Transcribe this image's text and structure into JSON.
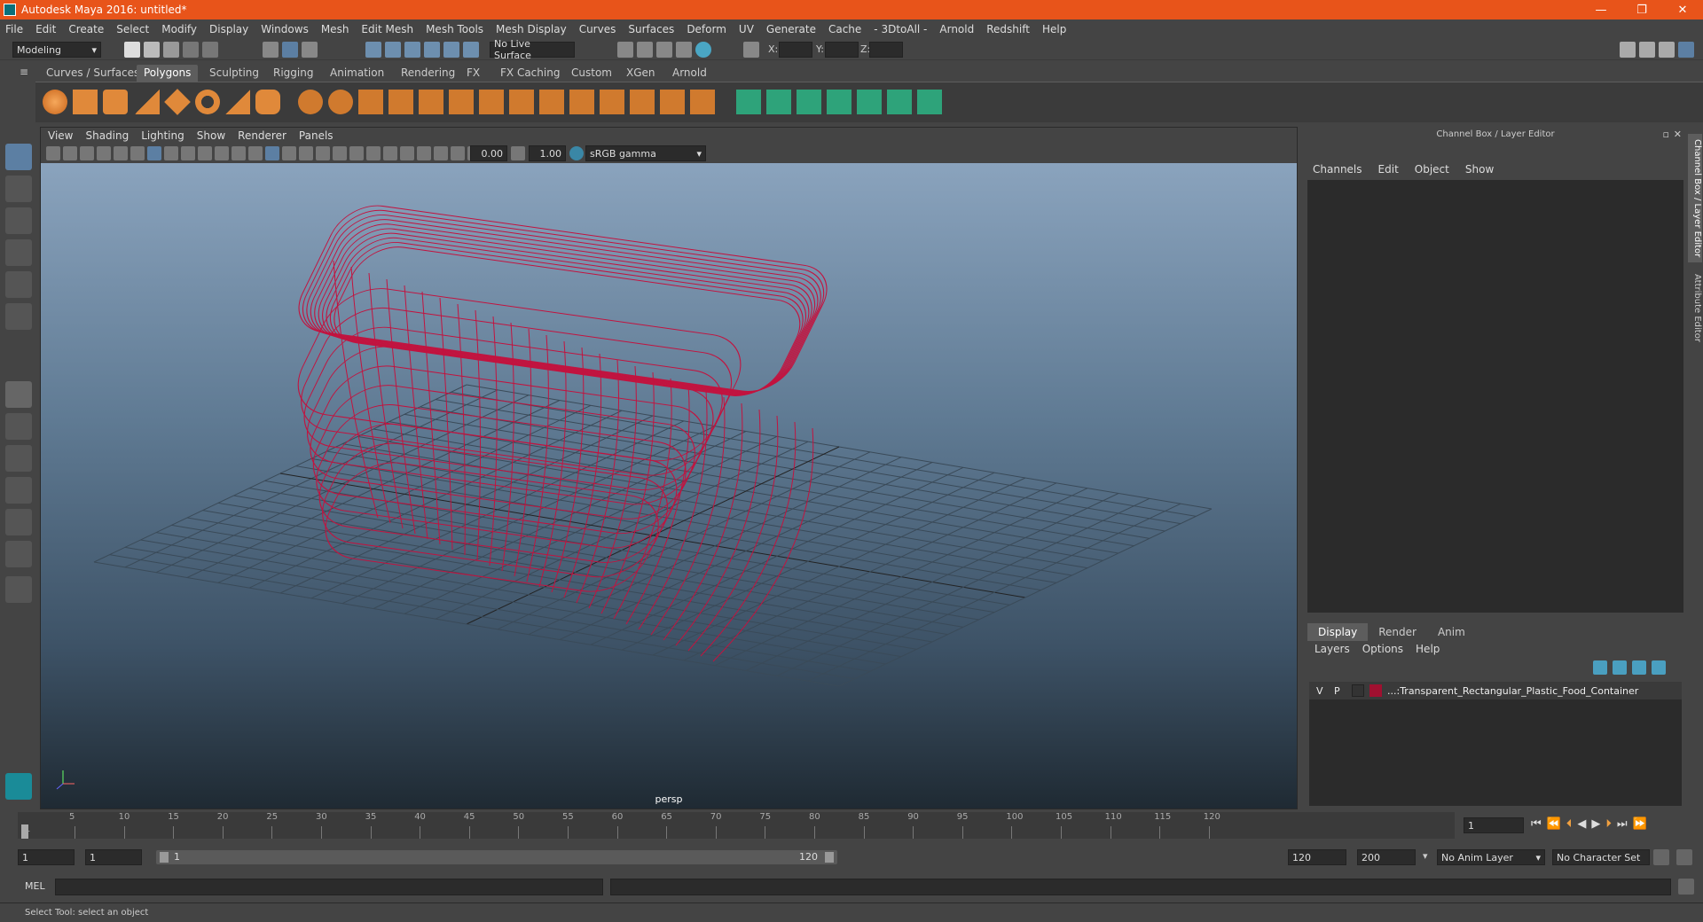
{
  "window": {
    "title": "Autodesk Maya 2016: untitled*",
    "buttons": [
      "—",
      "❐",
      "✕"
    ]
  },
  "menubar": [
    "File",
    "Edit",
    "Create",
    "Select",
    "Modify",
    "Display",
    "Windows",
    "Mesh",
    "Edit Mesh",
    "Mesh Tools",
    "Mesh Display",
    "Curves",
    "Surfaces",
    "Deform",
    "UV",
    "Generate",
    "Cache",
    "- 3DtoAll -",
    "Arnold",
    "Redshift",
    "Help"
  ],
  "statusline": {
    "mode": "Modeling",
    "live_surface": "No Live Surface",
    "x_label": "X:",
    "y_label": "Y:",
    "z_label": "Z:"
  },
  "shelf_tabs": [
    {
      "label": "Curves / Surfaces",
      "active": false
    },
    {
      "label": "Polygons",
      "active": true
    },
    {
      "label": "Sculpting",
      "active": false
    },
    {
      "label": "Rigging",
      "active": false
    },
    {
      "label": "Animation",
      "active": false
    },
    {
      "label": "Rendering",
      "active": false
    },
    {
      "label": "FX",
      "active": false
    },
    {
      "label": "FX Caching",
      "active": false
    },
    {
      "label": "Custom",
      "active": false
    },
    {
      "label": "XGen",
      "active": false
    },
    {
      "label": "Arnold",
      "active": false
    }
  ],
  "viewport": {
    "menu": [
      "View",
      "Shading",
      "Lighting",
      "Show",
      "Renderer",
      "Panels"
    ],
    "exposure": "0.00",
    "gamma": "1.00",
    "color_space": "sRGB gamma",
    "camera_label": "persp",
    "wire_color": "#c2133f"
  },
  "channelbox": {
    "title": "Channel Box / Layer Editor",
    "menu": [
      "Channels",
      "Edit",
      "Object",
      "Show"
    ],
    "layer_tabs": [
      {
        "label": "Display",
        "active": true
      },
      {
        "label": "Render",
        "active": false
      },
      {
        "label": "Anim",
        "active": false
      }
    ],
    "layer_menu": [
      "Layers",
      "Options",
      "Help"
    ],
    "layer": {
      "v": "V",
      "p": "P",
      "name": "...:Transparent_Rectangular_Plastic_Food_Container",
      "color": "#a01030"
    }
  },
  "side_tabs": [
    "Channel Box / Layer Editor",
    "Attribute Editor"
  ],
  "timeslider": {
    "ticks": [
      "5",
      "10",
      "15",
      "20",
      "25",
      "30",
      "35",
      "40",
      "45",
      "50",
      "55",
      "60",
      "65",
      "70",
      "75",
      "80",
      "85",
      "90",
      "95",
      "100",
      "105",
      "110",
      "115",
      "120"
    ],
    "start_tick": "1",
    "current_frame": "1"
  },
  "range": {
    "start": "1",
    "inner_start": "1",
    "slider_start": "1",
    "slider_end": "120",
    "end": "120",
    "max_end": "200",
    "anim_layer": "No Anim Layer",
    "character_set": "No Character Set"
  },
  "cmdline": {
    "label": "MEL"
  },
  "helpline": {
    "text": "Select Tool: select an object"
  }
}
